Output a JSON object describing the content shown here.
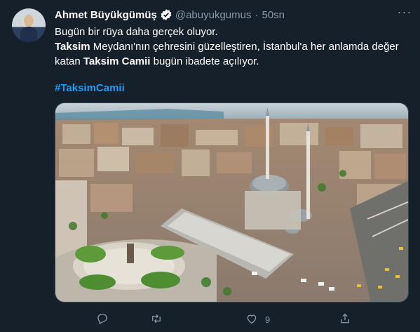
{
  "tweet": {
    "author_name": "Ahmet Büyükgümüş",
    "handle": "@abuyukgumus",
    "separator": "·",
    "time": "50sn",
    "more_label": "···",
    "line1": "Bugün bir rüya daha gerçek oluyor.",
    "line2_bold": "Taksim",
    "line2_rest": " Meydanı'nın çehresini güzelleştiren, İstanbul'a her anlamda değer",
    "line3_start": "katan ",
    "line3_bold": "Taksim Camii",
    "line3_rest": " bugün ibadete açılıyor.",
    "hashtag": "#TaksimCamii",
    "like_count": "9"
  },
  "colors": {
    "background": "#15202b",
    "text": "#ffffff",
    "muted": "#8899a6",
    "accent": "#1d9bf0",
    "border": "#38444d"
  },
  "icons": {
    "verified": "verified-badge-icon",
    "reply": "reply-icon",
    "retweet": "retweet-icon",
    "like": "heart-icon",
    "share": "share-icon",
    "more": "more-icon"
  }
}
